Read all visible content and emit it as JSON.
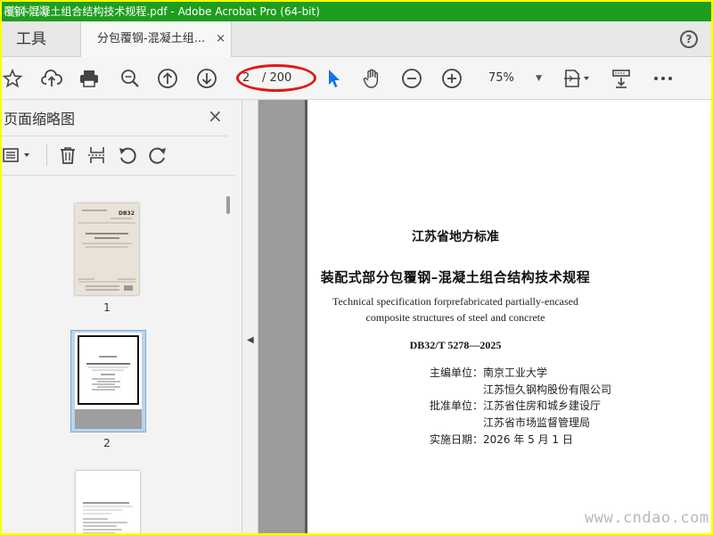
{
  "window": {
    "title": "覆钢-混凝土组合结构技术规程.pdf - Adobe Acrobat Pro (64-bit)",
    "watermark_top": "道林网"
  },
  "tabs": {
    "tools_label": "工具",
    "document_label": "分包覆钢-混凝土组...",
    "close_glyph": "×",
    "help_glyph": "?"
  },
  "toolbar": {
    "icons": [
      "star-icon",
      "cloud-upload-icon",
      "print-icon",
      "zoom-search-icon",
      "page-up-icon",
      "page-down-icon",
      "select-cursor-icon",
      "hand-tool-icon",
      "zoom-out-icon",
      "zoom-in-icon",
      "page-fit-icon",
      "stamp-tool-icon",
      "more-icon"
    ],
    "page_current": "2",
    "page_total": "/ 200",
    "zoom_value": "75%"
  },
  "left_panel": {
    "title": "页面缩略图",
    "close_glyph": "×",
    "thumbnails": [
      {
        "label": "1"
      },
      {
        "label": "2"
      },
      {
        "label": ""
      }
    ],
    "thumb1": {
      "code": "DB32",
      "title": "装配式部分包覆钢-混凝土组合结构技术规程"
    }
  },
  "document_page": {
    "standard_type": "江苏省地方标准",
    "title_cn": "装配式部分包覆钢–混凝土组合结构技术规程",
    "title_en_line1": "Technical specification forprefabricated partially-encased",
    "title_en_line2": "composite structures of steel and concrete",
    "code": "DB32/T 5278—2025",
    "rows": [
      {
        "label": "主编单位：",
        "value": "南京工业大学"
      },
      {
        "label": "",
        "value": "江苏恒久钢构股份有限公司"
      },
      {
        "label": "批准单位：",
        "value": "江苏省住房和城乡建设厅"
      },
      {
        "label": "",
        "value": "江苏省市场监督管理局"
      },
      {
        "label": "实施日期：",
        "value": "2026 年 5 月 1 日"
      }
    ]
  },
  "watermark_bottom": "www.cndao.com",
  "colors": {
    "titlebar": "#1e9e1e",
    "frame_border": "#ffff00",
    "annotation_ellipse": "#e01818",
    "select_cursor": "#1473e6",
    "thumb_selected": "#b8d4ec"
  }
}
